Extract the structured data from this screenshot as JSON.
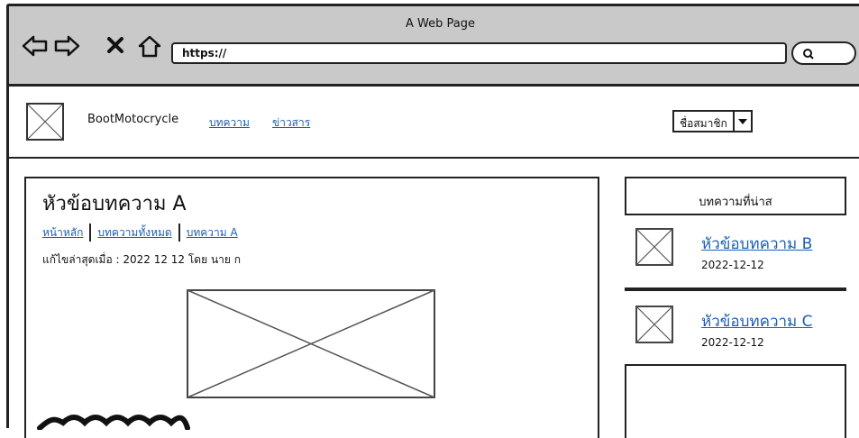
{
  "browser": {
    "window_title": "A Web Page",
    "url": "https://"
  },
  "site": {
    "brand": "BootMotocrycle",
    "nav": [
      "บทความ",
      "ข่าวสาร"
    ],
    "member_select": "ชื่อสมาชิก"
  },
  "article": {
    "title": "หัวข้อบทความ A",
    "breadcrumbs": [
      "หน้าหลัก",
      "บทความทั้งหมด",
      "บทความ A"
    ],
    "meta": "แก้ไขล่าสุดเมื่อ : 2022 12 12 โดย นาย ก"
  },
  "sidebar": {
    "title": "บทความที่น่าส",
    "items": [
      {
        "title": "หัวข้อบทความ B",
        "date": "2022-12-12"
      },
      {
        "title": "หัวข้อบทความ C",
        "date": "2022-12-12"
      }
    ]
  }
}
